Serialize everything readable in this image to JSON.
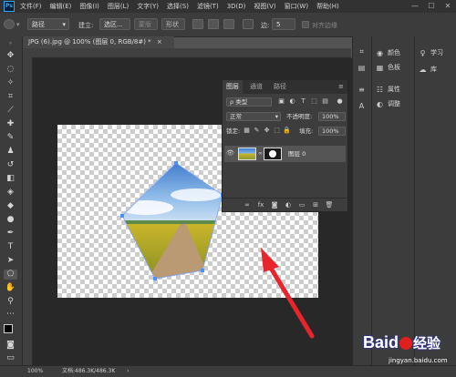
{
  "menubar": {
    "logo": "Ps",
    "items": [
      "文件(F)",
      "编辑(E)",
      "图像(I)",
      "图层(L)",
      "文字(Y)",
      "选择(S)",
      "滤镜(T)",
      "3D(D)",
      "视图(V)",
      "窗口(W)",
      "帮助(H)"
    ],
    "window_controls": [
      "—",
      "☐",
      "✕"
    ]
  },
  "options_bar": {
    "mode_value": "路径",
    "build_label": "建立:",
    "selection_button": "选区...",
    "mask_button": "蒙版",
    "shape_button": "形状",
    "sides_label": "边:",
    "sides_value": "5",
    "align_edges_label": "对齐边缘"
  },
  "document": {
    "tab_title": "JPG (6).jpg @ 100% (图层 0, RGB/8#) *",
    "tab_close": "×"
  },
  "layers_panel": {
    "tabs": [
      "图层",
      "通道",
      "路径"
    ],
    "kind_filter": "ρ 类型",
    "blend_mode": "正常",
    "opacity_label": "不透明度:",
    "opacity_value": "100%",
    "lock_label": "锁定:",
    "fill_label": "填充:",
    "fill_value": "100%",
    "layer_name": "图层 0",
    "bottom_icons": [
      "link-icon",
      "fx-icon",
      "mask-icon",
      "adjustment-icon",
      "folder-icon",
      "new-layer-icon",
      "trash-icon"
    ]
  },
  "right_panels": {
    "color": "颜色",
    "swatches": "色板",
    "properties": "属性",
    "adjustments": "调整",
    "learn": "学习",
    "libraries": "库"
  },
  "status_bar": {
    "zoom": "100%",
    "doc_info": "文档:486.3K/486.3K",
    "arrow": "›"
  },
  "watermark": {
    "brand": "Baid",
    "brand_cn": "经验",
    "url": "jingyan.baidu.com"
  },
  "colors": {
    "accent_arrow": "#e8242c",
    "selection_anchor": "#4a90ff",
    "watermark_blue": "#2932e1"
  }
}
